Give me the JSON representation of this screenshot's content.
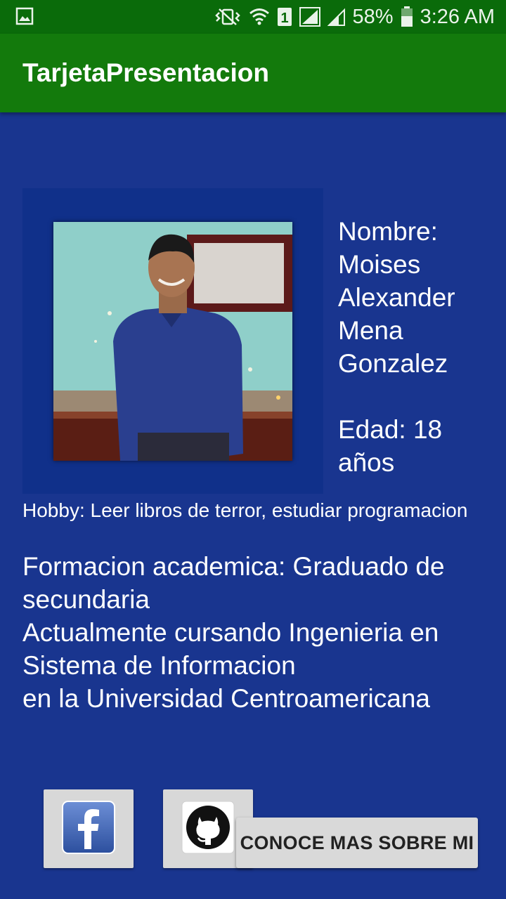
{
  "status_bar": {
    "battery": "58%",
    "time": "3:26 AM",
    "sim_slot": "1",
    "icons": [
      "gallery-icon",
      "vibrate-icon",
      "wifi-icon",
      "sim-icon",
      "signal-icon",
      "signal-icon",
      "battery-icon"
    ]
  },
  "app_bar": {
    "title": "TarjetaPresentacion"
  },
  "profile": {
    "photo_icon": "profile-photo",
    "name_label": "Nombre: Moises Alexander Mena Gonzalez",
    "age_label": "Edad: 18 años",
    "hobby": "Hobby: Leer libros de terror, estudiar programacion",
    "formacion": "Formacion academica: Graduado de secundaria\nActualmente cursando Ingenieria en Sistema de Informacion\n en la Universidad Centroamericana"
  },
  "buttons": {
    "facebook_icon": "facebook-icon",
    "github_icon": "github-icon",
    "more_label": "CONOCE MAS SOBRE MI"
  },
  "colors": {
    "background": "#19358f",
    "app_bar": "#137a0c",
    "status_bar": "#0a6b0a"
  }
}
